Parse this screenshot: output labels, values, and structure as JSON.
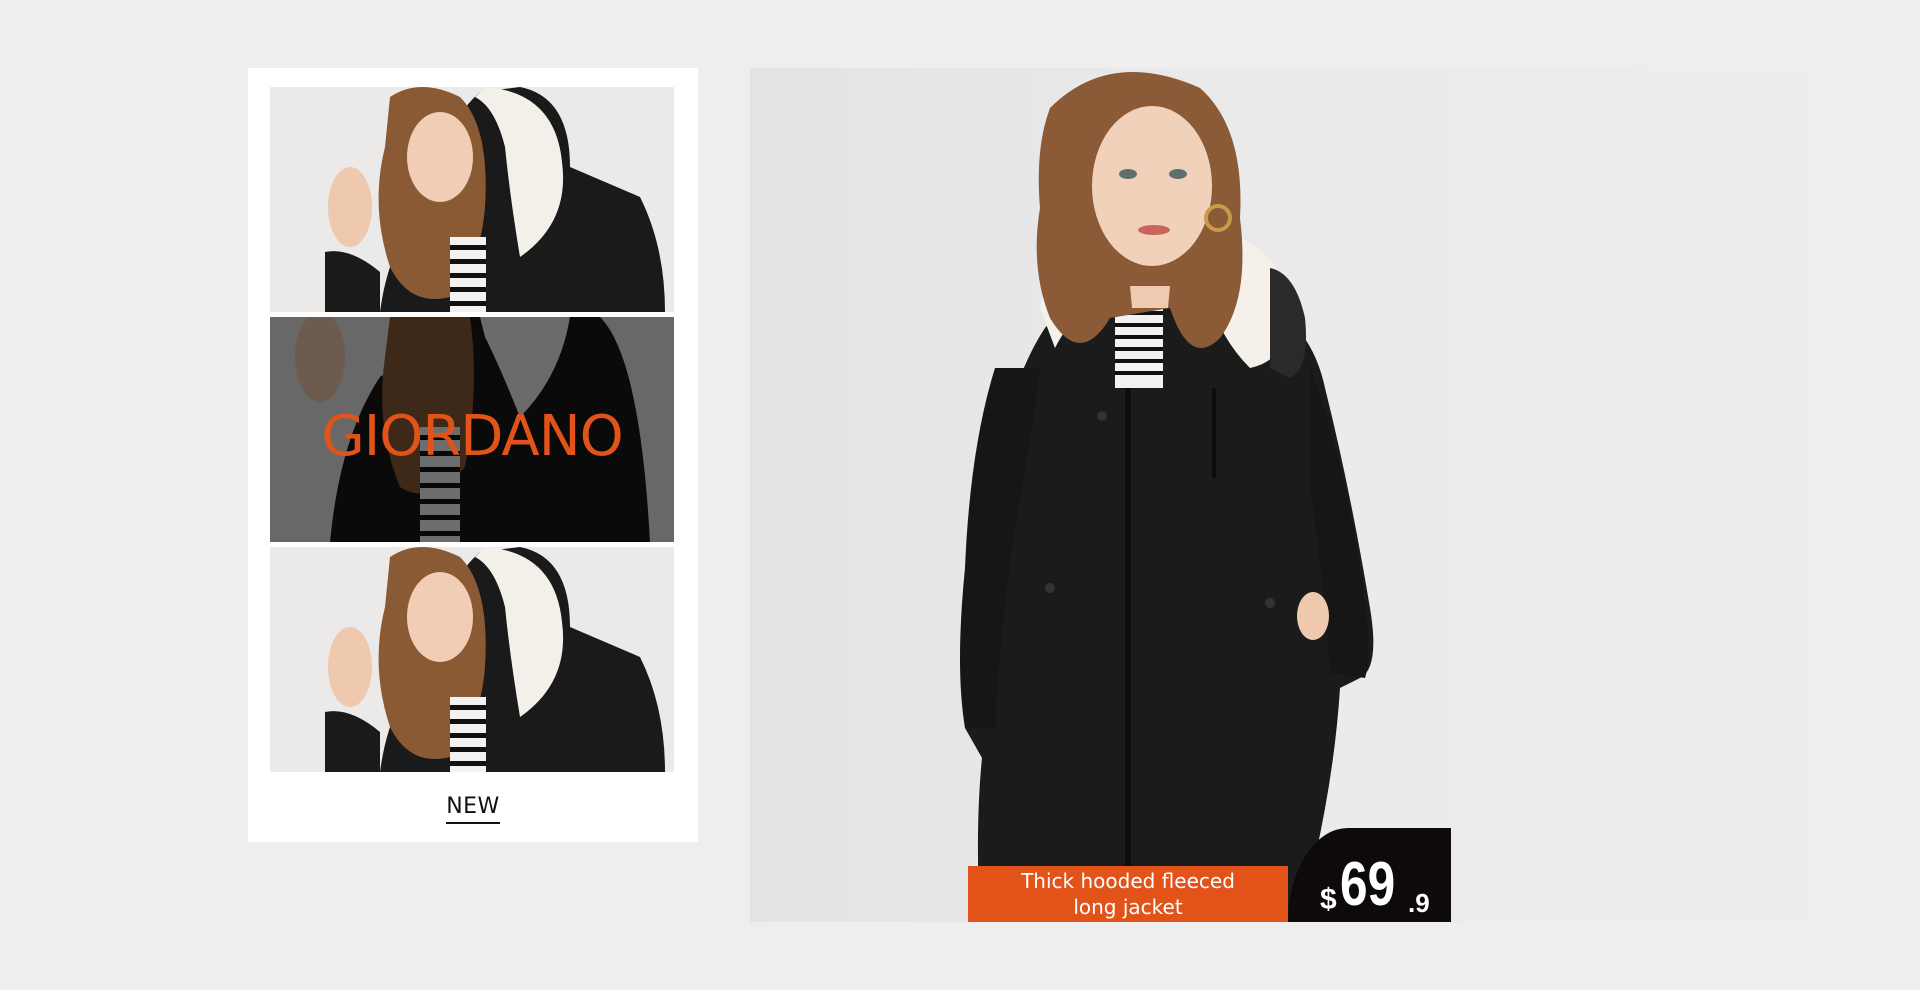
{
  "left_card": {
    "brand": "GIORDANO",
    "new_label": "NEW"
  },
  "hero": {
    "product_name_line1": "Thick hooded fleeced",
    "product_name_line2": "long jacket",
    "price_currency": "$",
    "price_main": "69",
    "price_cents": ".9"
  },
  "colors": {
    "accent": "#e2531a",
    "price_tag": "#0e0a09",
    "background": "#eeeeee",
    "card": "#ffffff"
  }
}
